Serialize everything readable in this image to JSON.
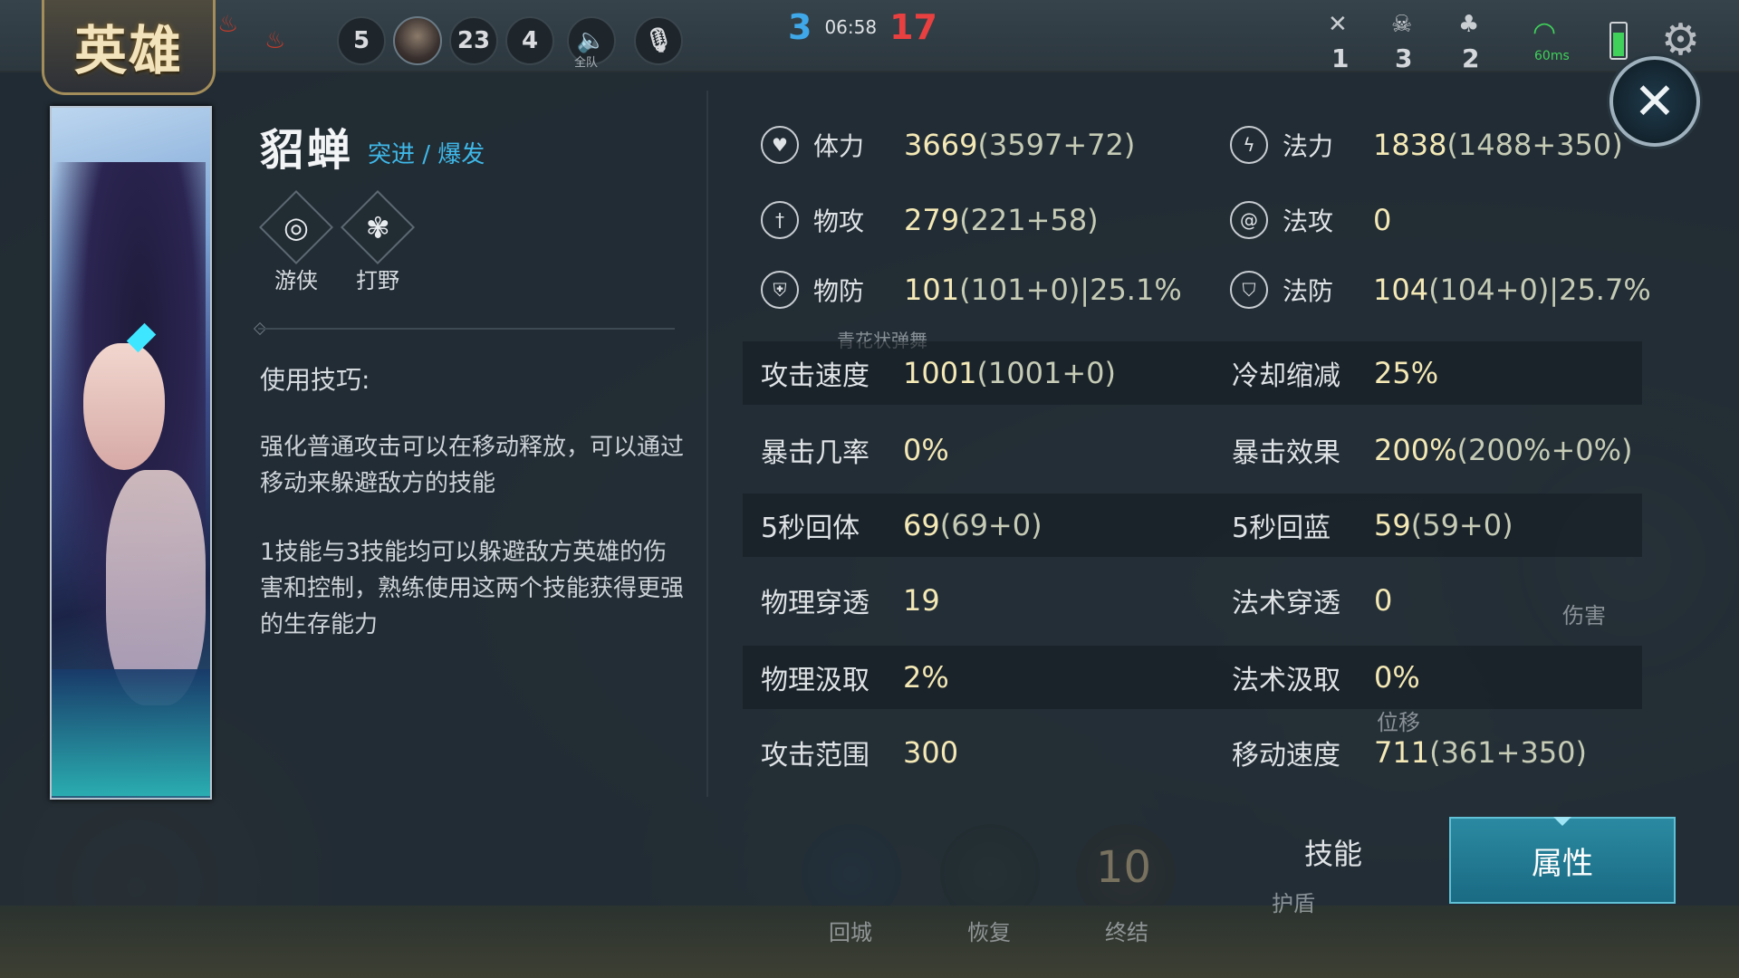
{
  "top_bar": {
    "tab_title": "英雄",
    "counters": [
      "5",
      "23",
      "4"
    ],
    "voice_label": "全队",
    "score": {
      "blue": "3",
      "time": "06:58",
      "red": "17"
    },
    "kda": [
      "1",
      "3",
      "2"
    ],
    "network": "60ms"
  },
  "hero": {
    "name": "貂蝉",
    "roles_text": "突进 / 爆发",
    "positions": [
      {
        "label": "游侠",
        "icon": "swirl-icon"
      },
      {
        "label": "打野",
        "icon": "paw-icon"
      }
    ],
    "tips_title": "使用技巧:",
    "tips": [
      "强化普通攻击可以在移动释放，可以通过移动来躲避敌方的技能",
      "1技能与3技能均可以躲避敌方英雄的伤害和控制，熟练使用这两个技能获得更强的生存能力"
    ]
  },
  "stats_top": [
    {
      "label": "体力",
      "value": "3669",
      "detail": "(3597+72)",
      "icon": "heart-icon"
    },
    {
      "label": "法力",
      "value": "1838",
      "detail": "(1488+350)",
      "icon": "lightning-icon"
    },
    {
      "label": "物攻",
      "value": "279",
      "detail": "(221+58)",
      "icon": "sword-icon"
    },
    {
      "label": "法攻",
      "value": "0",
      "detail": "",
      "icon": "spiral-icon"
    },
    {
      "label": "物防",
      "value": "101",
      "detail": "(101+0)|25.1%",
      "icon": "shield-icon"
    },
    {
      "label": "法防",
      "value": "104",
      "detail": "(104+0)|25.7%",
      "icon": "magic-shield-icon"
    }
  ],
  "stats_rows": [
    [
      {
        "label": "攻击速度",
        "value": "1001",
        "detail": "(1001+0)"
      },
      {
        "label": "冷却缩减",
        "value": "25%",
        "detail": ""
      }
    ],
    [
      {
        "label": "暴击几率",
        "value": "0%",
        "detail": ""
      },
      {
        "label": "暴击效果",
        "value": "200%",
        "detail": "(200%+0%)"
      }
    ],
    [
      {
        "label": "5秒回体",
        "value": "69",
        "detail": "(69+0)"
      },
      {
        "label": "5秒回蓝",
        "value": "59",
        "detail": "(59+0)"
      }
    ],
    [
      {
        "label": "物理穿透",
        "value": "19",
        "detail": ""
      },
      {
        "label": "法术穿透",
        "value": "0",
        "detail": ""
      }
    ],
    [
      {
        "label": "物理汲取",
        "value": "2%",
        "detail": ""
      },
      {
        "label": "法术汲取",
        "value": "0%",
        "detail": ""
      }
    ],
    [
      {
        "label": "攻击范围",
        "value": "300",
        "detail": ""
      },
      {
        "label": "移动速度",
        "value": "711",
        "detail": "(361+350)"
      }
    ]
  ],
  "tabs": {
    "skills": "技能",
    "attributes": "属性"
  },
  "background_labels": {
    "stale_name": "青花状弹舞",
    "damage": "伤害",
    "displace": "位移",
    "shield": "护盾",
    "recall": "回城",
    "heal": "恢复",
    "finish": "终结",
    "cooldown": "10"
  },
  "colors": {
    "accent": "#3fb8e8",
    "value": "#f4e9b6",
    "tab_active": "#1a6a83",
    "blue_team": "#3fa8e8",
    "red_team": "#e84040"
  }
}
